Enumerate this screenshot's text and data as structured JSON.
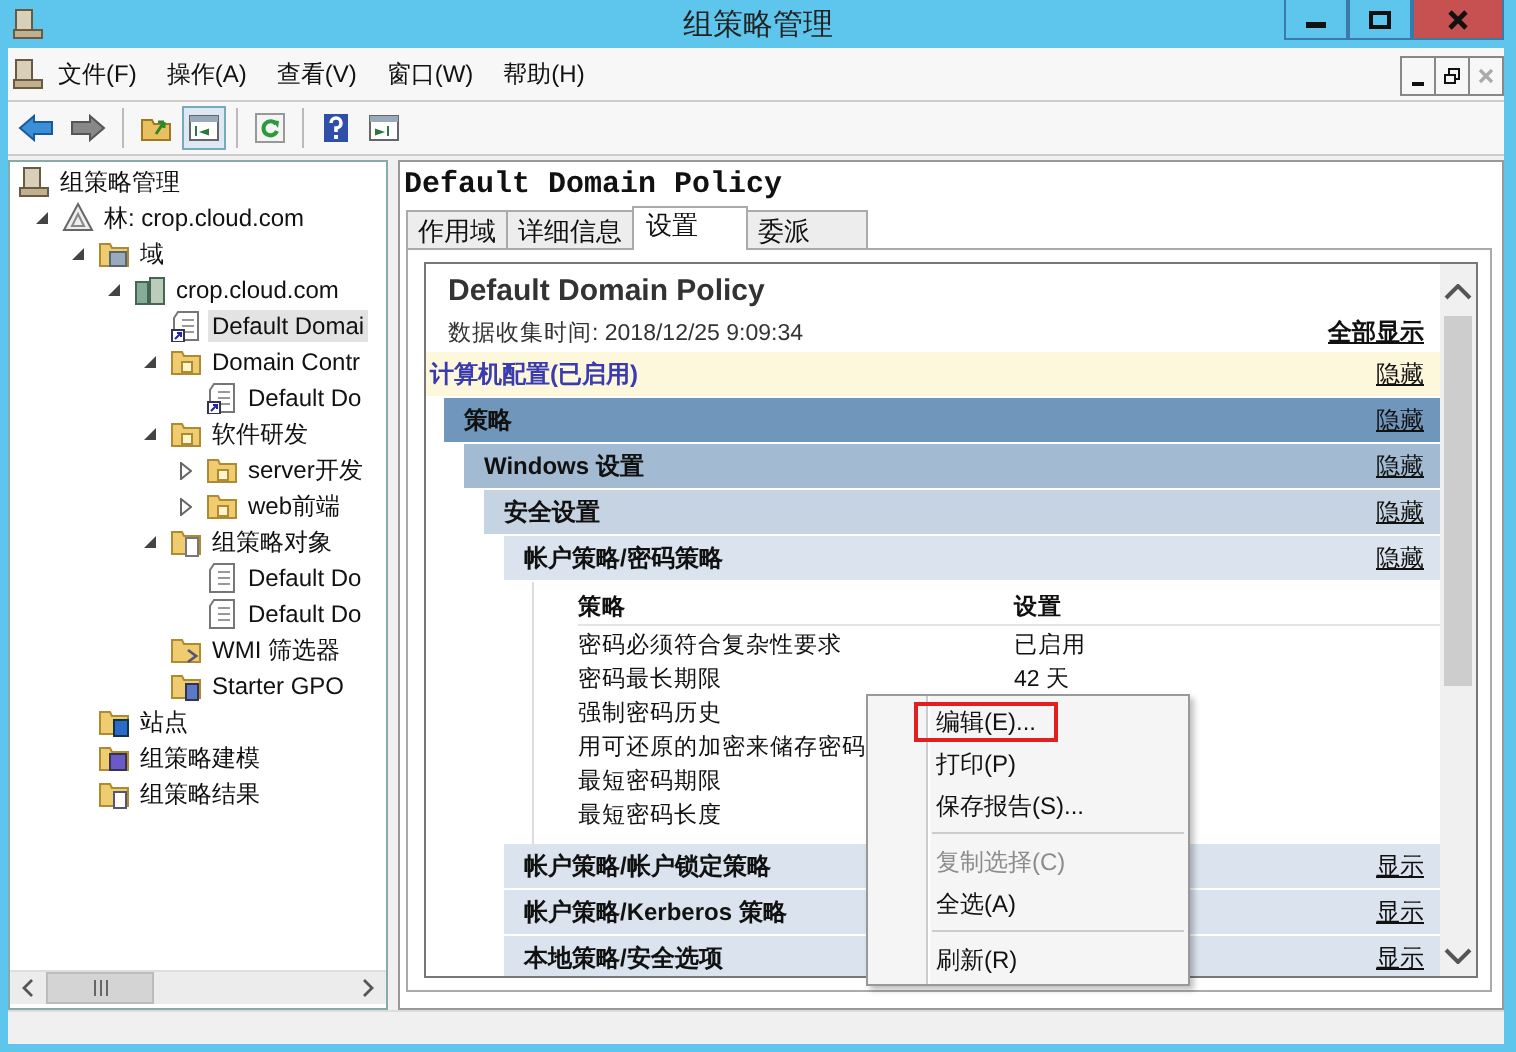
{
  "window": {
    "title": "组策略管理"
  },
  "menu_bar": [
    "文件(F)",
    "操作(A)",
    "查看(V)",
    "窗口(W)",
    "帮助(H)"
  ],
  "tree": [
    {
      "label": "组策略管理",
      "kind": "root",
      "selected": false,
      "children": [
        {
          "label": "林: crop.cloud.com",
          "kind": "forest",
          "expanded": true,
          "selected": false,
          "children": [
            {
              "label": "域",
              "kind": "domains",
              "expanded": true,
              "selected": false,
              "children": [
                {
                  "label": "crop.cloud.com",
                  "kind": "domain",
                  "expanded": true,
                  "selected": false,
                  "children": [
                    {
                      "label": "Default Domai",
                      "kind": "gpo-link",
                      "selected": true
                    },
                    {
                      "label": "Domain Contr",
                      "kind": "ou",
                      "expanded": true,
                      "selected": false,
                      "children": [
                        {
                          "label": "Default Do",
                          "kind": "gpo-link",
                          "selected": false
                        }
                      ]
                    },
                    {
                      "label": "软件研发",
                      "kind": "ou",
                      "expanded": true,
                      "selected": false,
                      "children": [
                        {
                          "label": "server开发",
                          "kind": "ou",
                          "expanded": false,
                          "selected": false
                        },
                        {
                          "label": "web前端",
                          "kind": "ou",
                          "expanded": false,
                          "selected": false
                        }
                      ]
                    },
                    {
                      "label": "组策略对象",
                      "kind": "gpo-folder",
                      "expanded": true,
                      "selected": false,
                      "children": [
                        {
                          "label": "Default Do",
                          "kind": "gpo",
                          "selected": false
                        },
                        {
                          "label": "Default Do",
                          "kind": "gpo",
                          "selected": false
                        }
                      ]
                    },
                    {
                      "label": "WMI 筛选器",
                      "kind": "wmi",
                      "selected": false
                    },
                    {
                      "label": "Starter GPO",
                      "kind": "starter",
                      "selected": false
                    }
                  ]
                }
              ]
            },
            {
              "label": "站点",
              "kind": "sites",
              "selected": false
            },
            {
              "label": "组策略建模",
              "kind": "modeling",
              "selected": false
            },
            {
              "label": "组策略结果",
              "kind": "results",
              "selected": false
            }
          ]
        }
      ]
    }
  ],
  "details": {
    "title": "Default Domain Policy",
    "tabs": [
      {
        "label": "作用域",
        "selected": false
      },
      {
        "label": "详细信息",
        "selected": false
      },
      {
        "label": "设置",
        "selected": true
      },
      {
        "label": "委派",
        "selected": false
      }
    ],
    "report": {
      "heading": "Default Domain Policy",
      "collected": "数据收集时间: 2018/12/25 9:09:34",
      "show_all": "全部显示",
      "sections": [
        {
          "title": "计算机配置(已启用)",
          "toggle": "隐藏",
          "children": [
            {
              "title": "策略",
              "toggle": "隐藏",
              "children": [
                {
                  "title": "Windows 设置",
                  "toggle": "隐藏",
                  "children": [
                    {
                      "title": "安全设置",
                      "toggle": "隐藏",
                      "children": [
                        {
                          "title": "帐户策略/密码策略",
                          "toggle": "隐藏",
                          "table": {
                            "columns": [
                              "策略",
                              "设置"
                            ],
                            "rows": [
                              {
                                "policy": "密码必须符合复杂性要求",
                                "setting": "已启用"
                              },
                              {
                                "policy": "密码最长期限",
                                "setting": "42 天"
                              },
                              {
                                "policy": "强制密码历史"
                              },
                              {
                                "policy": "用可还原的加密来储存密码"
                              },
                              {
                                "policy": "最短密码期限"
                              },
                              {
                                "policy": "最短密码长度"
                              }
                            ]
                          }
                        },
                        {
                          "title": "帐户策略/帐户锁定策略",
                          "toggle": "显示"
                        },
                        {
                          "title": "帐户策略/Kerberos 策略",
                          "toggle": "显示"
                        },
                        {
                          "title": "本地策略/安全选项",
                          "toggle": "显示"
                        }
                      ]
                    }
                  ]
                }
              ]
            }
          ]
        }
      ]
    }
  },
  "context_menu": {
    "items": [
      {
        "label": "编辑(E)...",
        "highlighted": true,
        "disabled": false
      },
      {
        "label": "打印(P)",
        "highlighted": false,
        "disabled": false
      },
      {
        "label": "保存报告(S)...",
        "highlighted": false,
        "disabled": false,
        "separator_after": true
      },
      {
        "label": "复制选择(C)",
        "highlighted": false,
        "disabled": true
      },
      {
        "label": "全选(A)",
        "highlighted": false,
        "disabled": false,
        "separator_after": true
      },
      {
        "label": "刷新(R)",
        "highlighted": false,
        "disabled": false
      }
    ]
  }
}
